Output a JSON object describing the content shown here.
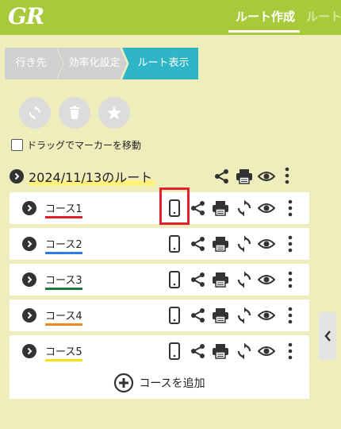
{
  "app": {
    "logo": "GR"
  },
  "tabs": {
    "active": "ルート作成",
    "next": "ルート"
  },
  "steps": [
    "行き先",
    "効率化設定",
    "ルート表示"
  ],
  "toolbar_icons": [
    "refresh-icon",
    "trash-icon",
    "star-icon"
  ],
  "drag_marker_label": "ドラッグでマーカーを移動",
  "route": {
    "title": "2024/11/13のルート"
  },
  "courses": [
    {
      "label": "コース1",
      "color": "#e0212b"
    },
    {
      "label": "コース2",
      "color": "#2f7ce6"
    },
    {
      "label": "コース3",
      "color": "#1f7a3a"
    },
    {
      "label": "コース4",
      "color": "#f08a1c"
    },
    {
      "label": "コース5",
      "color": "#f2e01a"
    }
  ],
  "add_course_label": "コースを追加",
  "colors": {
    "header": "#a8c93a",
    "active_step": "#2eb5c8",
    "background": "#f0edbd",
    "highlight": "#e0212b"
  }
}
